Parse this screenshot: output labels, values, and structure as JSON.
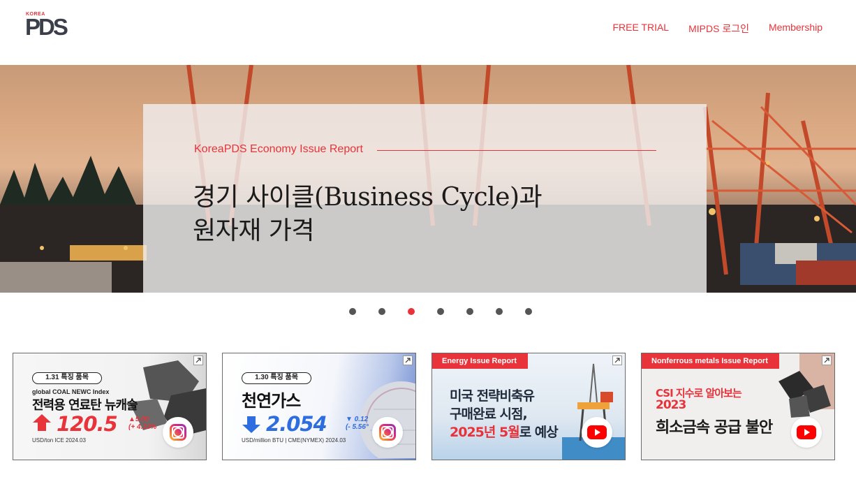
{
  "brand": {
    "korea": "KOREA",
    "mark": "PDS"
  },
  "nav": {
    "items": [
      "FREE TRIAL",
      "MIPDS 로그인",
      "Membership"
    ]
  },
  "hero": {
    "kicker": "KoreaPDS Economy Issue Report",
    "title_line1": "경기 사이클(Business Cycle)과",
    "title_line2": "원자재 가격"
  },
  "carousel": {
    "count": 7,
    "active_index": 2
  },
  "cards": [
    {
      "pill": "1.31 특징 품목",
      "subtitle": "global COAL NEWC Index",
      "headline": "전력용 연료탄 뉴캐슬",
      "value": "120.5",
      "delta_top": "▲5.00",
      "delta_bottom": "(+ 4.33%",
      "footer": "USD/ton      ICE 2024.03",
      "social": "instagram-icon",
      "value_color": "#e8333a"
    },
    {
      "pill": "1.30 특징 품목",
      "headline": "천연가스",
      "value": "2.054",
      "delta_top": "▼ 0.12",
      "delta_bottom": "(- 5.56°",
      "footer": "USD/million BTU | CME(NYMEX) 2024.03",
      "social": "instagram-icon",
      "value_color": "#2d6de0"
    },
    {
      "tag": "Energy Issue Report",
      "line1": "미국 전략비축유",
      "line2": "구매완료 시점,",
      "line3_red": "2025년 5월",
      "line3_rest": "로 예상",
      "social": "youtube-icon"
    },
    {
      "tag": "Nonferrous metals Issue Report",
      "line1": "CSI 지수로 알아보는",
      "line2": "2023",
      "line3": "희소금속 공급 불안",
      "social": "youtube-icon"
    }
  ],
  "colors": {
    "accent": "#e8333a",
    "dot": "#555555"
  }
}
